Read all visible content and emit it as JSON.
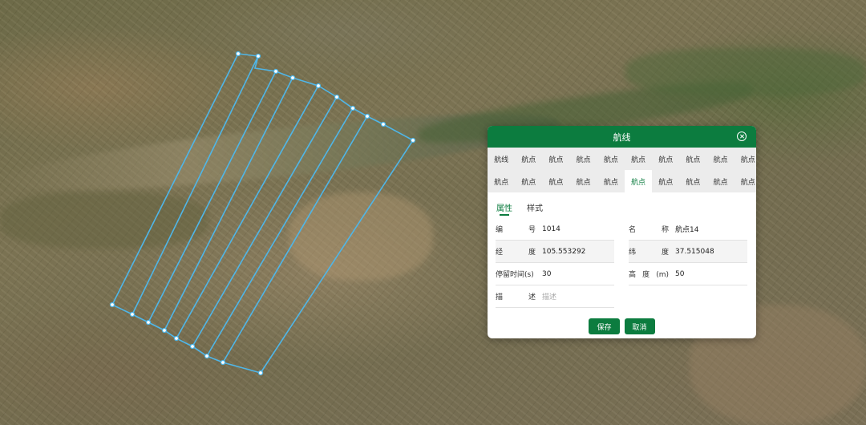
{
  "dialog": {
    "title": "航线",
    "tabs_row1": [
      "航线",
      "航点",
      "航点",
      "航点",
      "航点",
      "航点",
      "航点",
      "航点",
      "航点",
      "航点"
    ],
    "tabs_row2": [
      "航点",
      "航点",
      "航点",
      "航点",
      "航点",
      "航点",
      "航点",
      "航点",
      "航点",
      "航点"
    ],
    "active_tab_row2_index": 5,
    "sub_tabs": [
      "属性",
      "样式"
    ],
    "fields": {
      "number": {
        "label": "编号",
        "value": "1014"
      },
      "name": {
        "label": "名称",
        "value": "航点14"
      },
      "longitude": {
        "label": "经度",
        "value": "105.553292"
      },
      "latitude": {
        "label": "纬度",
        "value": "37.515048"
      },
      "stay_time": {
        "label": "停留时间(s)",
        "value": "30"
      },
      "altitude": {
        "label": "高度(m)",
        "value": "50"
      },
      "description": {
        "label": "描述",
        "placeholder": "描述"
      }
    },
    "buttons": {
      "save": "保存",
      "cancel": "取消"
    }
  },
  "colors": {
    "primary": "#0c7c3f",
    "route_line": "#4fb6e8"
  }
}
